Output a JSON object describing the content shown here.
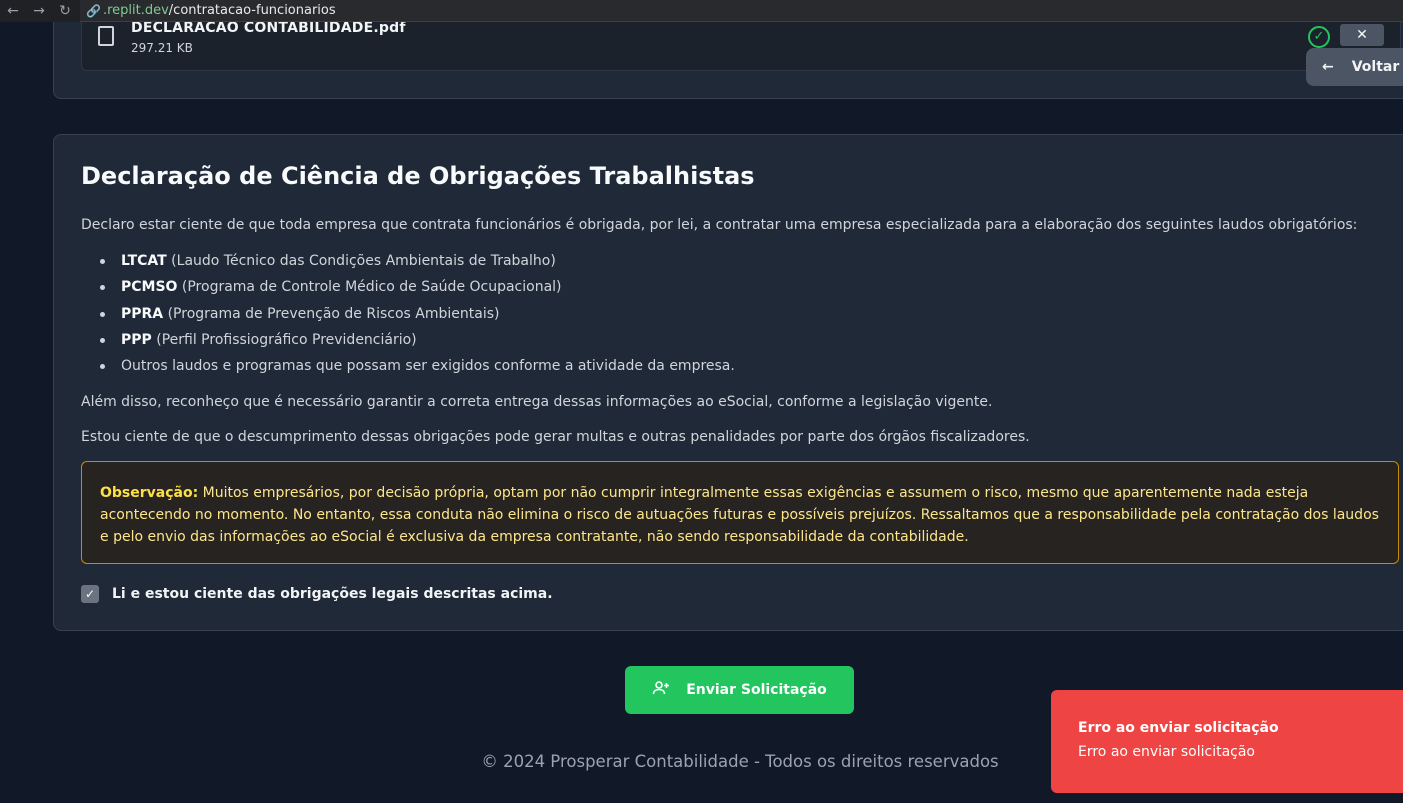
{
  "browser": {
    "url_host": ".replit.dev",
    "url_path": "/contratacao-funcionarios"
  },
  "attachment": {
    "file_name": "DECLARACAO CONTABILIDADE.pdf",
    "file_size": "297.21 KB",
    "back_label": "Voltar a"
  },
  "declaration": {
    "title": "Declaração de Ciência de Obrigações Trabalhistas",
    "intro": "Declaro estar ciente de que toda empresa que contrata funcionários é obrigada, por lei, a contratar uma empresa especializada para a elaboração dos seguintes laudos obrigatórios:",
    "items": [
      {
        "abbr": "LTCAT",
        "desc": " (Laudo Técnico das Condições Ambientais de Trabalho)"
      },
      {
        "abbr": "PCMSO",
        "desc": " (Programa de Controle Médico de Saúde Ocupacional)"
      },
      {
        "abbr": "PPRA",
        "desc": " (Programa de Prevenção de Riscos Ambientais)"
      },
      {
        "abbr": "PPP",
        "desc": " (Perfil Profissiográfico Previdenciário)"
      },
      {
        "abbr": "",
        "desc": "Outros laudos e programas que possam ser exigidos conforme a atividade da empresa."
      }
    ],
    "para_esocial": "Além disso, reconheço que é necessário garantir a correta entrega dessas informações ao eSocial, conforme a legislação vigente.",
    "para_penalties": "Estou ciente de que o descumprimento dessas obrigações pode gerar multas e outras penalidades por parte dos órgãos fiscalizadores.",
    "observation_label": "Observação:",
    "observation_text": " Muitos empresários, por decisão própria, optam por não cumprir integralmente essas exigências e assumem o risco, mesmo que aparentemente nada esteja acontecendo no momento. No entanto, essa conduta não elimina o risco de autuações futuras e possíveis prejuízos. Ressaltamos que a responsabilidade pela contratação dos laudos e pelo envio das informações ao eSocial é exclusiva da empresa contratante, não sendo responsabilidade da contabilidade.",
    "checkbox_label": "Li e estou ciente das obrigações legais descritas acima.",
    "checkbox_checked": true
  },
  "actions": {
    "submit_label": "Enviar Solicitação"
  },
  "footer": {
    "text": "© 2024 Prosperar Contabilidade - Todos os direitos reservados"
  },
  "toast": {
    "title": "Erro ao enviar solicitação",
    "description": "Erro ao enviar solicitação"
  },
  "colors": {
    "background": "#111827",
    "card": "#1f2937",
    "success": "#22c55e",
    "warning": "#ca8a04",
    "error": "#ef4444"
  }
}
